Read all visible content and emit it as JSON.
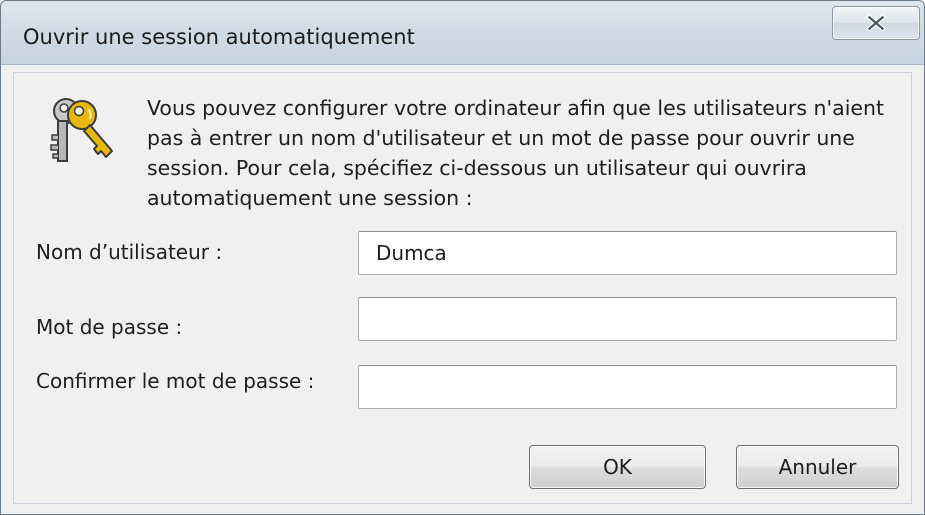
{
  "window": {
    "title": "Ouvrir une session automatiquement"
  },
  "dialog": {
    "icon": "keys-icon",
    "description": "Vous pouvez configurer votre ordinateur afin que les utilisateurs n'aient pas à entrer un nom d'utilisateur et un mot de passe pour ouvrir une session. Pour cela, spécifiez ci-dessous un utilisateur qui ouvrira automatiquement une session :"
  },
  "fields": {
    "username": {
      "label": "Nom d’utilisateur :",
      "value": "Dumca"
    },
    "password": {
      "label": "Mot de passe :",
      "value": ""
    },
    "confirm_password": {
      "label": "Confirmer le mot de passe :",
      "value": ""
    }
  },
  "buttons": {
    "ok": "OK",
    "cancel": "Annuler"
  },
  "colors": {
    "titlebar": "#d2dce7",
    "client_background": "#f0f0f0",
    "key_gold": "#e8b80c"
  }
}
